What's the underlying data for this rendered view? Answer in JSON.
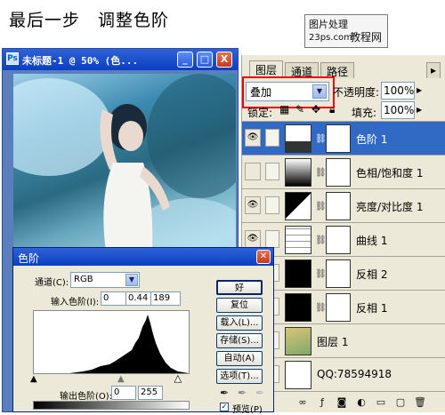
{
  "header": {
    "title": "最后一步　调整色阶",
    "logo_line1": "图片处理",
    "logo_line2": "23ps.com",
    "logo_line3": "教程网"
  },
  "image_window": {
    "title": "未标题-1 @ 50% (色...",
    "min_label": "_",
    "max_label": "□",
    "close_label": "X"
  },
  "layers_panel": {
    "tabs": [
      {
        "label": "图层",
        "active": true
      },
      {
        "label": "通道",
        "active": false
      },
      {
        "label": "路径",
        "active": false
      }
    ],
    "blend_mode": "叠加",
    "opacity_label": "不透明度:",
    "opacity_value": "100%",
    "lock_label": "锁定:",
    "fill_label": "填充:",
    "fill_value": "100%",
    "layers": [
      {
        "name": "色阶 1",
        "selected": true,
        "visible": true
      },
      {
        "name": "色相/饱和度 1",
        "selected": false,
        "visible": false
      },
      {
        "name": "亮度/对比度 1",
        "selected": false,
        "visible": true
      },
      {
        "name": "曲线 1",
        "selected": false,
        "visible": true
      },
      {
        "name": "反相 2",
        "selected": false,
        "visible": false
      },
      {
        "name": "反相 1",
        "selected": false,
        "visible": false
      },
      {
        "name": "图层 1",
        "selected": false,
        "visible": false
      },
      {
        "name": "QQ:78594918",
        "selected": false,
        "visible": false
      }
    ]
  },
  "levels_dialog": {
    "title": "色阶",
    "channel_label": "通道(C):",
    "channel_value": "RGB",
    "input_label": "输入色阶(I):",
    "input_values": [
      "0",
      "0.44",
      "189"
    ],
    "output_label": "输出色阶(O):",
    "output_values": [
      "0",
      "255"
    ],
    "buttons": [
      "好",
      "复位",
      "载入(L)...",
      "存储(S)...",
      "自动(A)",
      "选项(T)..."
    ],
    "preview_label": "预览(P)",
    "preview_checked": true,
    "highlight_color": "#e00000",
    "selection_color": "#316ac5"
  }
}
